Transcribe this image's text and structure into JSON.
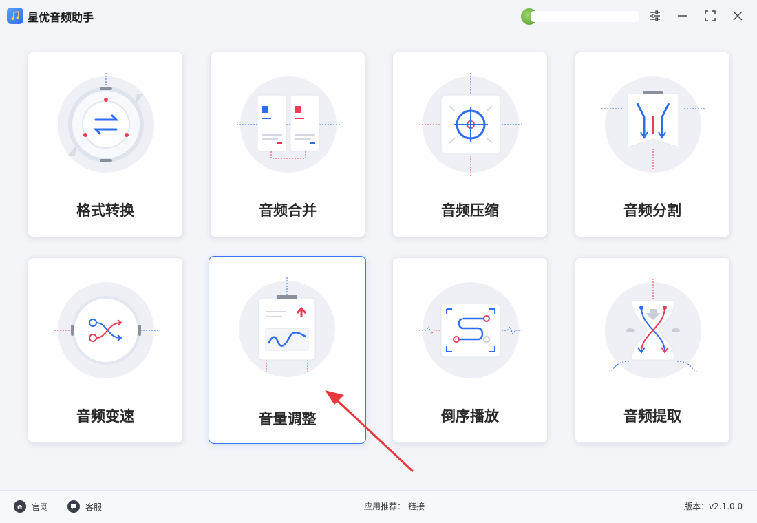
{
  "app": {
    "title": "星优音频助手"
  },
  "titlebar": {
    "settings_icon": "sliders-icon",
    "minimize_icon": "minimize-icon",
    "maximize_icon": "maximize-icon",
    "close_icon": "close-icon"
  },
  "cards": [
    {
      "label": "格式转换",
      "icon": "format-convert-icon"
    },
    {
      "label": "音频合并",
      "icon": "audio-merge-icon"
    },
    {
      "label": "音频压缩",
      "icon": "audio-compress-icon"
    },
    {
      "label": "音频分割",
      "icon": "audio-split-icon"
    },
    {
      "label": "音频变速",
      "icon": "audio-speed-icon"
    },
    {
      "label": "音量调整",
      "icon": "volume-adjust-icon",
      "selected": true
    },
    {
      "label": "倒序播放",
      "icon": "reverse-play-icon"
    },
    {
      "label": "音频提取",
      "icon": "audio-extract-icon"
    }
  ],
  "footer": {
    "website": "官网",
    "support": "客服",
    "recommend_label": "应用推荐：",
    "recommend_link": "链接",
    "version_label": "版本：",
    "version": "v2.1.0.0"
  },
  "colors": {
    "accent_blue": "#2f6df0",
    "accent_red": "#ee3b5a",
    "selected_border": "#3b74f0",
    "annotation_arrow": "#e8383d"
  }
}
